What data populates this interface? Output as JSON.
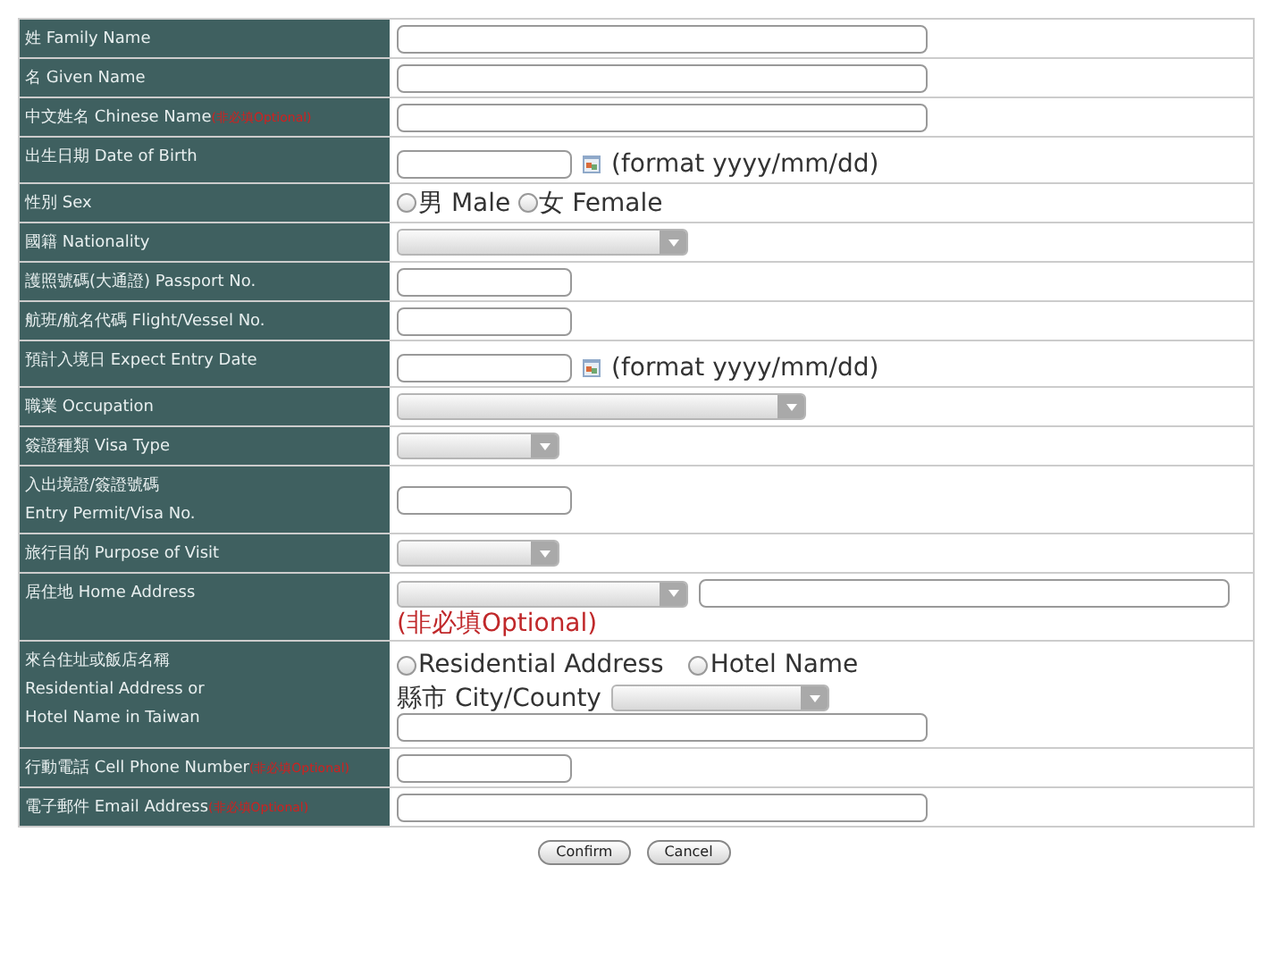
{
  "rows": [
    {
      "label": [
        "姓 Family Name"
      ],
      "field": {
        "kind": "longtext"
      }
    },
    {
      "label": [
        "名 Given Name"
      ],
      "field": {
        "kind": "longtext"
      }
    },
    {
      "label": [
        "中文姓名 Chinese Name"
      ],
      "note": "(非必填Optional)",
      "field": {
        "kind": "longtext"
      }
    },
    {
      "label": [
        "出生日期 Date of Birth"
      ],
      "field": {
        "kind": "date",
        "hint": "(format yyyy/mm/dd)"
      }
    },
    {
      "label": [
        "性別 Sex"
      ],
      "field": {
        "kind": "radio",
        "options": [
          {
            "label": "男 Male",
            "selected": false
          },
          {
            "label": "女 Female",
            "selected": false
          }
        ]
      }
    },
    {
      "label": [
        "國籍 Nationality"
      ],
      "field": {
        "kind": "mediumselect"
      }
    },
    {
      "label": [
        "護照號碼(大通證) Passport No."
      ],
      "field": {
        "kind": "shorttext"
      }
    },
    {
      "label": [
        "航班/航名代碼 Flight/Vessel No."
      ],
      "field": {
        "kind": "shorttext"
      }
    },
    {
      "label": [
        "預計入境日 Expect Entry Date"
      ],
      "field": {
        "kind": "date",
        "hint": "(format yyyy/mm/dd)"
      }
    },
    {
      "label": [
        "職業 Occupation"
      ],
      "field": {
        "kind": "longselect"
      }
    },
    {
      "label": [
        "簽證種類 Visa Type"
      ],
      "field": {
        "kind": "smallselect"
      }
    },
    {
      "label": [
        "入出境證/簽證號碼",
        "Entry Permit/Visa No."
      ],
      "field": {
        "kind": "shorttext"
      }
    },
    {
      "label": [
        "旅行目的 Purpose of Visit"
      ],
      "field": {
        "kind": "smallselect"
      }
    },
    {
      "label": [
        "居住地 Home Address"
      ],
      "field": {
        "kind": "home",
        "note": "(非必填Optional)"
      }
    },
    {
      "label": [
        "來台住址或飯店名稱",
        "Residential Address or",
        "Hotel Name in Taiwan"
      ],
      "field": {
        "kind": "stay",
        "options": [
          {
            "label": "Residential Address",
            "selected": false
          },
          {
            "label": "Hotel Name",
            "selected": false
          }
        ],
        "city_label": "縣市 City/County"
      }
    },
    {
      "label": [
        "行動電話 Cell Phone Number"
      ],
      "note": "(非必填Optional)",
      "field": {
        "kind": "shorttext"
      }
    },
    {
      "label": [
        "電子郵件 Email Address"
      ],
      "note": "(非必填Optional)",
      "field": {
        "kind": "longtext"
      }
    }
  ],
  "buttons": [
    "Confirm",
    "Cancel"
  ]
}
